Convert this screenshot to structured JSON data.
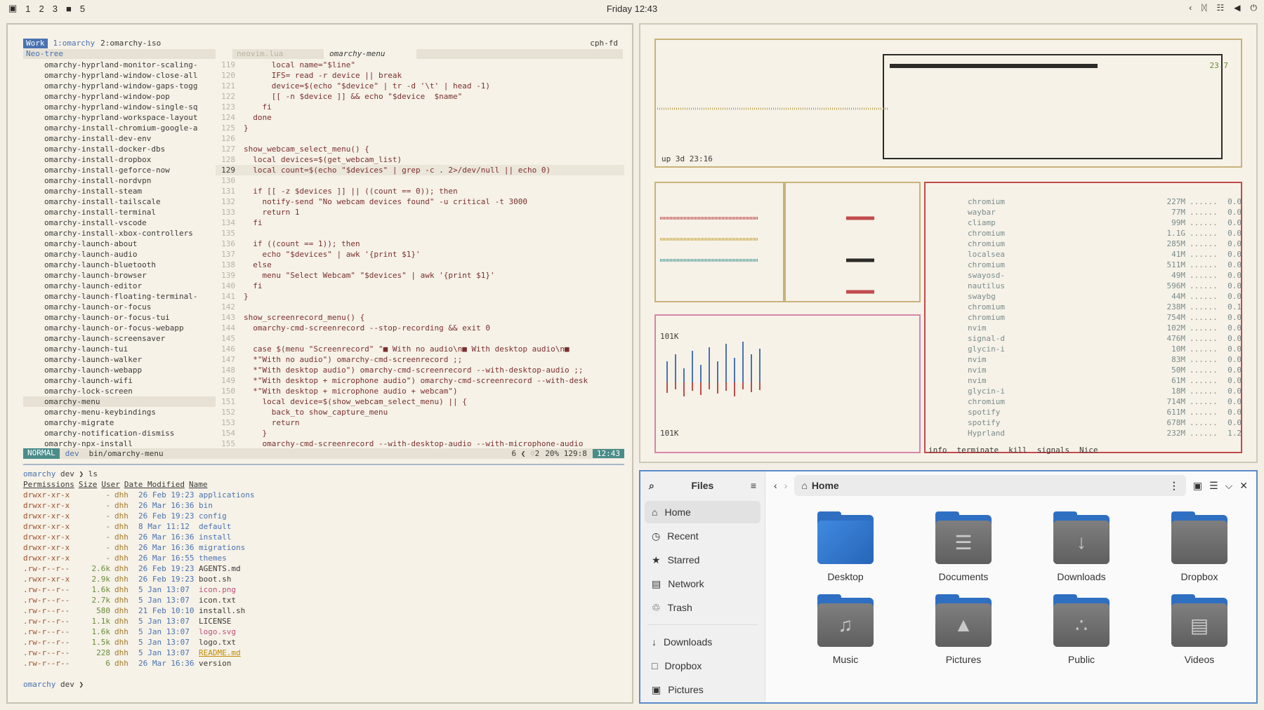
{
  "topbar": {
    "workspaces": [
      "1",
      "2",
      "3",
      "■",
      "5"
    ],
    "clock": "Friday 12:43",
    "tray_icons": [
      "chevron-left-icon",
      "bluetooth-icon",
      "network-icon",
      "volume-icon",
      "power-icon"
    ]
  },
  "tmux": {
    "session": "Work",
    "windows": [
      "1:omarchy",
      "2:omarchy-iso"
    ],
    "host": "cph-fd"
  },
  "nvim": {
    "tree_title": "Neo-tree",
    "tabs": [
      "neovim.lua",
      "omarchy-menu"
    ],
    "tree_items": [
      "omarchy-hyprland-monitor-scaling-",
      "omarchy-hyprland-window-close-all",
      "omarchy-hyprland-window-gaps-togg",
      "omarchy-hyprland-window-pop",
      "omarchy-hyprland-window-single-sq",
      "omarchy-hyprland-workspace-layout",
      "omarchy-install-chromium-google-a",
      "omarchy-install-dev-env",
      "omarchy-install-docker-dbs",
      "omarchy-install-dropbox",
      "omarchy-install-geforce-now",
      "omarchy-install-nordvpn",
      "omarchy-install-steam",
      "omarchy-install-tailscale",
      "omarchy-install-terminal",
      "omarchy-install-vscode",
      "omarchy-install-xbox-controllers",
      "omarchy-launch-about",
      "omarchy-launch-audio",
      "omarchy-launch-bluetooth",
      "omarchy-launch-browser",
      "omarchy-launch-editor",
      "omarchy-launch-floating-terminal-",
      "omarchy-launch-or-focus",
      "omarchy-launch-or-focus-tui",
      "omarchy-launch-or-focus-webapp",
      "omarchy-launch-screensaver",
      "omarchy-launch-tui",
      "omarchy-launch-walker",
      "omarchy-launch-webapp",
      "omarchy-launch-wifi",
      "omarchy-lock-screen",
      "omarchy-menu",
      "omarchy-menu-keybindings",
      "omarchy-migrate",
      "omarchy-notification-dismiss",
      "omarchy-npx-install"
    ],
    "code_lines": [
      {
        "n": "119",
        "t": "      local name=\"$line\""
      },
      {
        "n": "120",
        "t": "      IFS= read -r device || break"
      },
      {
        "n": "121",
        "t": "      device=$(echo \"$device\" | tr -d '\\t' | head -1)"
      },
      {
        "n": "122",
        "t": "      [[ -n $device ]] && echo \"$device  $name\""
      },
      {
        "n": "123",
        "t": "    fi"
      },
      {
        "n": "124",
        "t": "  done"
      },
      {
        "n": "125",
        "t": "}"
      },
      {
        "n": "126",
        "t": ""
      },
      {
        "n": "127",
        "t": "show_webcam_select_menu() {"
      },
      {
        "n": "128",
        "t": "  local devices=$(get_webcam_list)"
      },
      {
        "n": "129",
        "t": "  local count=$(echo \"$devices\" | grep -c . 2>/dev/null || echo 0)"
      },
      {
        "n": "130",
        "t": ""
      },
      {
        "n": "131",
        "t": "  if [[ -z $devices ]] || ((count == 0)); then"
      },
      {
        "n": "132",
        "t": "    notify-send \"No webcam devices found\" -u critical -t 3000"
      },
      {
        "n": "133",
        "t": "    return 1"
      },
      {
        "n": "134",
        "t": "  fi"
      },
      {
        "n": "135",
        "t": ""
      },
      {
        "n": "136",
        "t": "  if ((count == 1)); then"
      },
      {
        "n": "137",
        "t": "    echo \"$devices\" | awk '{print $1}'"
      },
      {
        "n": "138",
        "t": "  else"
      },
      {
        "n": "139",
        "t": "    menu \"Select Webcam\" \"$devices\" | awk '{print $1}'"
      },
      {
        "n": "140",
        "t": "  fi"
      },
      {
        "n": "141",
        "t": "}"
      },
      {
        "n": "142",
        "t": ""
      },
      {
        "n": "143",
        "t": "show_screenrecord_menu() {"
      },
      {
        "n": "144",
        "t": "  omarchy-cmd-screenrecord --stop-recording && exit 0"
      },
      {
        "n": "145",
        "t": ""
      },
      {
        "n": "146",
        "t": "  case $(menu \"Screenrecord\" \"■ With no audio\\n■ With desktop audio\\n■"
      },
      {
        "n": "147",
        "t": "  *\"With no audio\") omarchy-cmd-screenrecord ;;"
      },
      {
        "n": "148",
        "t": "  *\"With desktop audio\") omarchy-cmd-screenrecord --with-desktop-audio ;;"
      },
      {
        "n": "149",
        "t": "  *\"With desktop + microphone audio\") omarchy-cmd-screenrecord --with-desk"
      },
      {
        "n": "150",
        "t": "  *\"With desktop + microphone audio + webcam\")"
      },
      {
        "n": "151",
        "t": "    local device=$(show_webcam_select_menu) || {"
      },
      {
        "n": "152",
        "t": "      back_to show_capture_menu"
      },
      {
        "n": "153",
        "t": "      return"
      },
      {
        "n": "154",
        "t": "    }"
      },
      {
        "n": "155",
        "t": "    omarchy-cmd-screenrecord --with-desktop-audio --with-microphone-audio"
      }
    ],
    "status": {
      "mode": "NORMAL",
      "branch": "dev",
      "file": "bin/omarchy-menu",
      "info": "6 ❮ ♢2",
      "pos": "20% 129:8",
      "time": "12:43"
    }
  },
  "terminal": {
    "prompt_user": "omarchy",
    "prompt_dir": "dev",
    "command": "ls",
    "headers": [
      "Permissions",
      "Size",
      "User",
      "Date Modified",
      "Name"
    ],
    "rows": [
      {
        "perm": "drwxr-xr-x",
        "size": "-",
        "user": "dhh",
        "date": "26 Feb 19:23",
        "name": "applications",
        "kind": "dir"
      },
      {
        "perm": "drwxr-xr-x",
        "size": "-",
        "user": "dhh",
        "date": "26 Mar 16:36",
        "name": "bin",
        "kind": "dir"
      },
      {
        "perm": "drwxr-xr-x",
        "size": "-",
        "user": "dhh",
        "date": "26 Feb 19:23",
        "name": "config",
        "kind": "dir"
      },
      {
        "perm": "drwxr-xr-x",
        "size": "-",
        "user": "dhh",
        "date": "8 Mar 11:12",
        "name": "default",
        "kind": "dir"
      },
      {
        "perm": "drwxr-xr-x",
        "size": "-",
        "user": "dhh",
        "date": "26 Mar 16:36",
        "name": "install",
        "kind": "dir"
      },
      {
        "perm": "drwxr-xr-x",
        "size": "-",
        "user": "dhh",
        "date": "26 Mar 16:36",
        "name": "migrations",
        "kind": "dir"
      },
      {
        "perm": "drwxr-xr-x",
        "size": "-",
        "user": "dhh",
        "date": "26 Mar 16:55",
        "name": "themes",
        "kind": "dir"
      },
      {
        "perm": ".rw-r--r--",
        "size": "2.6k",
        "user": "dhh",
        "date": "26 Feb 19:23",
        "name": "AGENTS.md",
        "kind": "file"
      },
      {
        "perm": ".rwxr-xr-x",
        "size": "2.9k",
        "user": "dhh",
        "date": "26 Feb 19:23",
        "name": "boot.sh",
        "kind": "file"
      },
      {
        "perm": ".rw-r--r--",
        "size": "1.6k",
        "user": "dhh",
        "date": "5 Jan 13:07",
        "name": "icon.png",
        "kind": "img"
      },
      {
        "perm": ".rw-r--r--",
        "size": "2.7k",
        "user": "dhh",
        "date": "5 Jan 13:07",
        "name": "icon.txt",
        "kind": "file"
      },
      {
        "perm": ".rw-r--r--",
        "size": "580",
        "user": "dhh",
        "date": "21 Feb 10:10",
        "name": "install.sh",
        "kind": "file"
      },
      {
        "perm": ".rw-r--r--",
        "size": "1.1k",
        "user": "dhh",
        "date": "5 Jan 13:07",
        "name": "LICENSE",
        "kind": "file"
      },
      {
        "perm": ".rw-r--r--",
        "size": "1.6k",
        "user": "dhh",
        "date": "5 Jan 13:07",
        "name": "logo.svg",
        "kind": "img"
      },
      {
        "perm": ".rw-r--r--",
        "size": "1.5k",
        "user": "dhh",
        "date": "5 Jan 13:07",
        "name": "logo.txt",
        "kind": "file"
      },
      {
        "perm": ".rw-r--r--",
        "size": "228",
        "user": "dhh",
        "date": "5 Jan 13:07",
        "name": "README.md",
        "kind": "md"
      },
      {
        "perm": ".rw-r--r--",
        "size": "6",
        "user": "dhh",
        "date": "26 Mar 16:36",
        "name": "version",
        "kind": "file"
      }
    ]
  },
  "btop": {
    "uptime": "up 3d 23:16",
    "net_top": "101K",
    "net_bottom": "101K",
    "cpu_pct": "23.7",
    "processes": [
      {
        "name": "chromium",
        "mem": "227M",
        "cpu": "0.0"
      },
      {
        "name": "waybar",
        "mem": "77M",
        "cpu": "0.0"
      },
      {
        "name": "cliamp",
        "mem": "99M",
        "cpu": "0.0"
      },
      {
        "name": "chromium",
        "mem": "1.1G",
        "cpu": "0.0"
      },
      {
        "name": "chromium",
        "mem": "285M",
        "cpu": "0.0"
      },
      {
        "name": "localsea",
        "mem": "41M",
        "cpu": "0.0"
      },
      {
        "name": "chromium",
        "mem": "511M",
        "cpu": "0.0"
      },
      {
        "name": "swayosd-",
        "mem": "49M",
        "cpu": "0.0"
      },
      {
        "name": "nautilus",
        "mem": "596M",
        "cpu": "0.0"
      },
      {
        "name": "swaybg",
        "mem": "44M",
        "cpu": "0.0"
      },
      {
        "name": "chromium",
        "mem": "238M",
        "cpu": "0.1"
      },
      {
        "name": "chromium",
        "mem": "754M",
        "cpu": "0.0"
      },
      {
        "name": "nvim",
        "mem": "102M",
        "cpu": "0.0"
      },
      {
        "name": "signal-d",
        "mem": "476M",
        "cpu": "0.0"
      },
      {
        "name": "glycin-i",
        "mem": "10M",
        "cpu": "0.0"
      },
      {
        "name": "nvim",
        "mem": "83M",
        "cpu": "0.0"
      },
      {
        "name": "nvim",
        "mem": "50M",
        "cpu": "0.0"
      },
      {
        "name": "nvim",
        "mem": "61M",
        "cpu": "0.0"
      },
      {
        "name": "glycin-i",
        "mem": "18M",
        "cpu": "0.0"
      },
      {
        "name": "chromium",
        "mem": "714M",
        "cpu": "0.0"
      },
      {
        "name": "spotify",
        "mem": "611M",
        "cpu": "0.0"
      },
      {
        "name": "spotify",
        "mem": "678M",
        "cpu": "0.0"
      },
      {
        "name": "Hyprland",
        "mem": "232M",
        "cpu": "1.2"
      }
    ],
    "footer": [
      "info",
      "terminate",
      "kill",
      "signals",
      "Nice"
    ]
  },
  "files": {
    "title": "Files",
    "sidebar": [
      "Home",
      "Recent",
      "Starred",
      "Network",
      "Trash"
    ],
    "bookmarks": [
      "Downloads",
      "Dropbox",
      "Pictures"
    ],
    "path": "Home",
    "folders": [
      {
        "name": "Desktop",
        "icon": "desktop-folder-icon",
        "glyph": ""
      },
      {
        "name": "Documents",
        "icon": "documents-folder-icon",
        "glyph": "☰"
      },
      {
        "name": "Downloads",
        "icon": "downloads-folder-icon",
        "glyph": "↓"
      },
      {
        "name": "Dropbox",
        "icon": "dropbox-folder-icon",
        "glyph": ""
      },
      {
        "name": "Music",
        "icon": "music-folder-icon",
        "glyph": "♫"
      },
      {
        "name": "Pictures",
        "icon": "pictures-folder-icon",
        "glyph": "▲"
      },
      {
        "name": "Public",
        "icon": "public-folder-icon",
        "glyph": "∴"
      },
      {
        "name": "Videos",
        "icon": "videos-folder-icon",
        "glyph": "▤"
      }
    ]
  }
}
